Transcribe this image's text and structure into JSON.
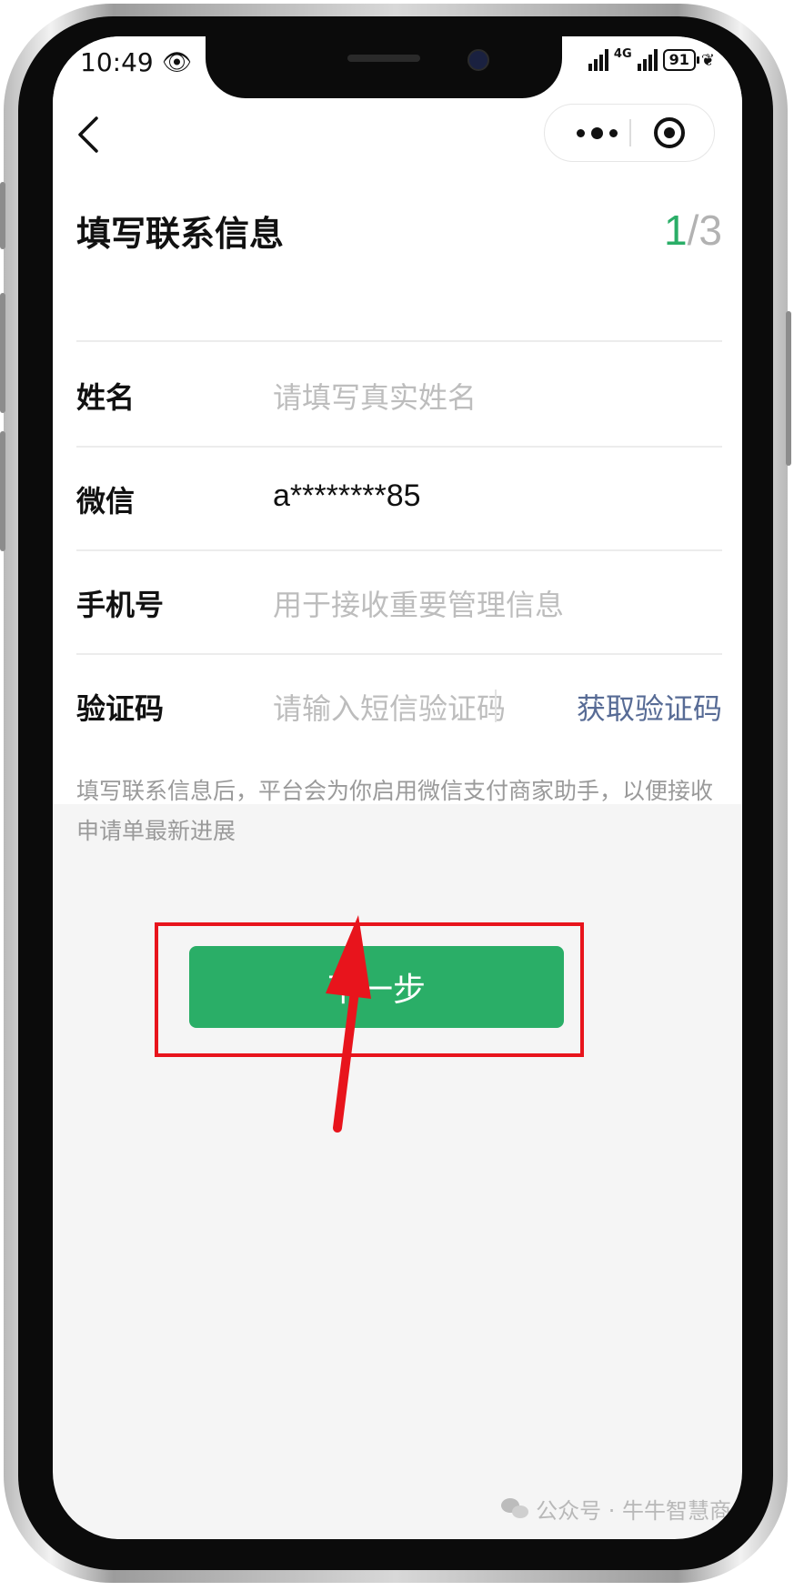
{
  "status_bar": {
    "time": "10:49",
    "network": "4G",
    "battery": "91"
  },
  "nav": {
    "back_icon": "chevron-left-icon",
    "more_icon": "more-dots-icon",
    "close_icon": "target-icon"
  },
  "page": {
    "title": "填写联系信息",
    "step_current": "1",
    "step_total": "/3"
  },
  "form": {
    "name_label": "姓名",
    "name_placeholder": "请填写真实姓名",
    "wechat_label": "微信",
    "wechat_value": "a********85",
    "phone_label": "手机号",
    "phone_placeholder": "用于接收重要管理信息",
    "code_label": "验证码",
    "code_placeholder": "请输入短信验证码",
    "get_code_label": "获取验证码"
  },
  "hint": "填写联系信息后，平台会为你启用微信支付商家助手，以便接收申请单最新进展",
  "next_button": "下一步",
  "watermark": "公众号 · 牛牛智慧商",
  "colors": {
    "accent_green": "#2aae67",
    "link_blue": "#576b95",
    "annotation_red": "#e8141c"
  }
}
